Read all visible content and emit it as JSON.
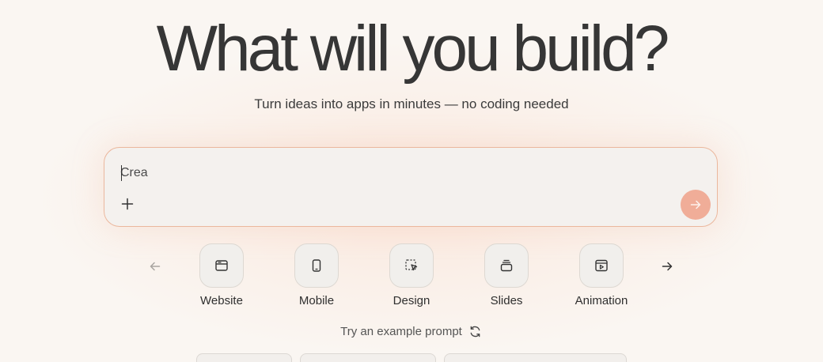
{
  "hero": {
    "title": "What will you build?",
    "subtitle": "Turn ideas into apps in minutes — no coding needed"
  },
  "prompt": {
    "value": "Crea",
    "placeholder": "",
    "attach_icon": "plus-icon",
    "send_icon": "arrow-right-icon",
    "send_color": "#f0ad98"
  },
  "categories": [
    {
      "label": "Website",
      "icon": "browser-window-icon"
    },
    {
      "label": "Mobile",
      "icon": "smartphone-icon"
    },
    {
      "label": "Design",
      "icon": "cursor-selection-icon"
    },
    {
      "label": "Slides",
      "icon": "stacked-slides-icon"
    },
    {
      "label": "Animation",
      "icon": "video-frame-icon"
    }
  ],
  "carousel": {
    "prev_icon": "arrow-left-icon",
    "next_icon": "arrow-right-icon"
  },
  "examples": {
    "label": "Try an example prompt",
    "refresh_icon": "refresh-icon"
  },
  "colors": {
    "background": "#faf6f2",
    "accent": "#f0ad98",
    "prompt_border": "#ebb79d"
  }
}
